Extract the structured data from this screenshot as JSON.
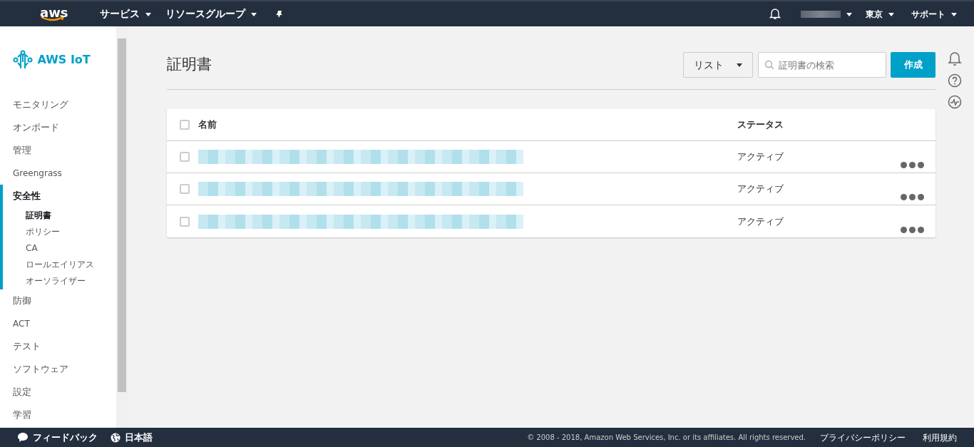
{
  "top_nav": {
    "logo": "aws",
    "menus": [
      {
        "label": "サービス"
      },
      {
        "label": "リソースグループ"
      }
    ],
    "right_menus": [
      {
        "label": "東京"
      },
      {
        "label": "サポート"
      }
    ]
  },
  "sidebar": {
    "title": "AWS IoT",
    "items": [
      {
        "label": "モニタリング",
        "selected": false
      },
      {
        "label": "オンボード",
        "selected": false
      },
      {
        "label": "管理",
        "selected": false
      },
      {
        "label": "Greengrass",
        "selected": false
      },
      {
        "label": "安全性",
        "selected": true,
        "children": [
          {
            "label": "証明書",
            "selected": true
          },
          {
            "label": "ポリシー",
            "selected": false
          },
          {
            "label": "CA",
            "selected": false
          },
          {
            "label": "ロールエイリアス",
            "selected": false
          },
          {
            "label": "オーソライザー",
            "selected": false
          }
        ]
      },
      {
        "label": "防御",
        "selected": false
      },
      {
        "label": "ACT",
        "selected": false
      },
      {
        "label": "テスト",
        "selected": false
      },
      {
        "label": "ソフトウェア",
        "selected": false
      },
      {
        "label": "設定",
        "selected": false
      },
      {
        "label": "学習",
        "selected": false
      }
    ]
  },
  "page": {
    "title": "証明書",
    "view_select": "リスト",
    "search": {
      "placeholder": "証明書の検索"
    },
    "create_button": "作成"
  },
  "table": {
    "select_all_checked": false,
    "columns": [
      "名前",
      "ステータス"
    ],
    "rows": [
      {
        "checked": false,
        "status": "アクティブ"
      },
      {
        "checked": false,
        "status": "アクティブ"
      },
      {
        "checked": false,
        "status": "アクティブ"
      }
    ]
  },
  "footer": {
    "feedback": "フィードバック",
    "language": "日本語",
    "copyright": "© 2008 - 2018, Amazon Web Services, Inc. or its affiliates. All rights reserved.",
    "links": [
      "プライバシーポリシー",
      "利用規約"
    ]
  }
}
